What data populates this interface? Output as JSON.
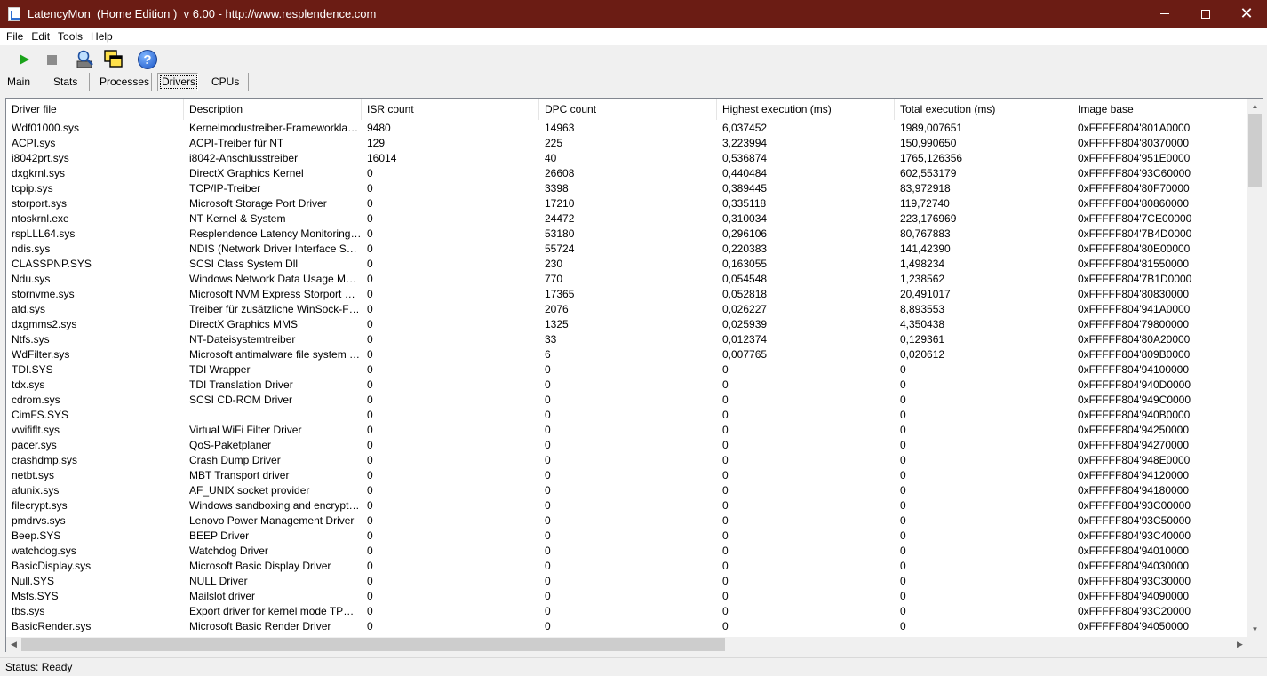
{
  "window": {
    "title": "LatencyMon  (Home Edition )  v 6.00 - http://www.resplendence.com"
  },
  "menu": [
    "File",
    "Edit",
    "Tools",
    "Help"
  ],
  "toolbar": {
    "start_icon": "play-icon",
    "stop_icon": "stop-icon",
    "find_icon": "magnifier-icon",
    "windows_icon": "cascade-windows-icon",
    "help_icon": "help-icon",
    "help_glyph": "?"
  },
  "tabs": [
    "Main",
    "Stats",
    "Processes",
    "Drivers",
    "CPUs"
  ],
  "selected_tab": "Drivers",
  "table": {
    "columns": [
      "Driver file",
      "Description",
      "ISR count",
      "DPC count",
      "Highest execution (ms)",
      "Total execution (ms)",
      "Image base"
    ],
    "rows": [
      [
        "Wdf01000.sys",
        "Kernelmodustreiber-Frameworklaufzeit",
        "9480",
        "14963",
        "6,037452",
        "1989,007651",
        "0xFFFFF804'801A0000"
      ],
      [
        "ACPI.sys",
        "ACPI-Treiber für NT",
        "129",
        "225",
        "3,223994",
        "150,990650",
        "0xFFFFF804'80370000"
      ],
      [
        "i8042prt.sys",
        "i8042-Anschlusstreiber",
        "16014",
        "40",
        "0,536874",
        "1765,126356",
        "0xFFFFF804'951E0000"
      ],
      [
        "dxgkrnl.sys",
        "DirectX Graphics Kernel",
        "0",
        "26608",
        "0,440484",
        "602,553179",
        "0xFFFFF804'93C60000"
      ],
      [
        "tcpip.sys",
        "TCP/IP-Treiber",
        "0",
        "3398",
        "0,389445",
        "83,972918",
        "0xFFFFF804'80F70000"
      ],
      [
        "storport.sys",
        "Microsoft Storage Port Driver",
        "0",
        "17210",
        "0,335118",
        "119,72740",
        "0xFFFFF804'80860000"
      ],
      [
        "ntoskrnl.exe",
        "NT Kernel & System",
        "0",
        "24472",
        "0,310034",
        "223,176969",
        "0xFFFFF804'7CE00000"
      ],
      [
        "rspLLL64.sys",
        "Resplendence Latency Monitoring a...",
        "0",
        "53180",
        "0,296106",
        "80,767883",
        "0xFFFFF804'7B4D0000"
      ],
      [
        "ndis.sys",
        "NDIS (Network Driver Interface Spe...",
        "0",
        "55724",
        "0,220383",
        "141,42390",
        "0xFFFFF804'80E00000"
      ],
      [
        "CLASSPNP.SYS",
        "SCSI Class System Dll",
        "0",
        "230",
        "0,163055",
        "1,498234",
        "0xFFFFF804'81550000"
      ],
      [
        "Ndu.sys",
        "Windows Network Data Usage Monit...",
        "0",
        "770",
        "0,054548",
        "1,238562",
        "0xFFFFF804'7B1D0000"
      ],
      [
        "stornvme.sys",
        "Microsoft NVM Express Storport Mini...",
        "0",
        "17365",
        "0,052818",
        "20,491017",
        "0xFFFFF804'80830000"
      ],
      [
        "afd.sys",
        "Treiber für zusätzliche WinSock-Fun...",
        "0",
        "2076",
        "0,026227",
        "8,893553",
        "0xFFFFF804'941A0000"
      ],
      [
        "dxgmms2.sys",
        "DirectX Graphics MMS",
        "0",
        "1325",
        "0,025939",
        "4,350438",
        "0xFFFFF804'79800000"
      ],
      [
        "Ntfs.sys",
        "NT-Dateisystemtreiber",
        "0",
        "33",
        "0,012374",
        "0,129361",
        "0xFFFFF804'80A20000"
      ],
      [
        "WdFilter.sys",
        "Microsoft antimalware file system filt...",
        "0",
        "6",
        "0,007765",
        "0,020612",
        "0xFFFFF804'809B0000"
      ],
      [
        "TDI.SYS",
        "TDI Wrapper",
        "0",
        "0",
        "0",
        "0",
        "0xFFFFF804'94100000"
      ],
      [
        "tdx.sys",
        "TDI Translation Driver",
        "0",
        "0",
        "0",
        "0",
        "0xFFFFF804'940D0000"
      ],
      [
        "cdrom.sys",
        "SCSI CD-ROM Driver",
        "0",
        "0",
        "0",
        "0",
        "0xFFFFF804'949C0000"
      ],
      [
        "CimFS.SYS",
        "",
        "0",
        "0",
        "0",
        "0",
        "0xFFFFF804'940B0000"
      ],
      [
        "vwififlt.sys",
        "Virtual WiFi Filter Driver",
        "0",
        "0",
        "0",
        "0",
        "0xFFFFF804'94250000"
      ],
      [
        "pacer.sys",
        "QoS-Paketplaner",
        "0",
        "0",
        "0",
        "0",
        "0xFFFFF804'94270000"
      ],
      [
        "crashdmp.sys",
        "Crash Dump Driver",
        "0",
        "0",
        "0",
        "0",
        "0xFFFFF804'948E0000"
      ],
      [
        "netbt.sys",
        "MBT Transport driver",
        "0",
        "0",
        "0",
        "0",
        "0xFFFFF804'94120000"
      ],
      [
        "afunix.sys",
        "AF_UNIX socket provider",
        "0",
        "0",
        "0",
        "0",
        "0xFFFFF804'94180000"
      ],
      [
        "filecrypt.sys",
        "Windows sandboxing and encryptio...",
        "0",
        "0",
        "0",
        "0",
        "0xFFFFF804'93C00000"
      ],
      [
        "pmdrvs.sys",
        "Lenovo Power Management Driver",
        "0",
        "0",
        "0",
        "0",
        "0xFFFFF804'93C50000"
      ],
      [
        "Beep.SYS",
        "BEEP Driver",
        "0",
        "0",
        "0",
        "0",
        "0xFFFFF804'93C40000"
      ],
      [
        "watchdog.sys",
        "Watchdog Driver",
        "0",
        "0",
        "0",
        "0",
        "0xFFFFF804'94010000"
      ],
      [
        "BasicDisplay.sys",
        "Microsoft Basic Display Driver",
        "0",
        "0",
        "0",
        "0",
        "0xFFFFF804'94030000"
      ],
      [
        "Null.SYS",
        "NULL Driver",
        "0",
        "0",
        "0",
        "0",
        "0xFFFFF804'93C30000"
      ],
      [
        "Msfs.SYS",
        "Mailslot driver",
        "0",
        "0",
        "0",
        "0",
        "0xFFFFF804'94090000"
      ],
      [
        "tbs.sys",
        "Export driver for kernel mode TPM API",
        "0",
        "0",
        "0",
        "0",
        "0xFFFFF804'93C20000"
      ],
      [
        "BasicRender.sys",
        "Microsoft Basic Render Driver",
        "0",
        "0",
        "0",
        "0",
        "0xFFFFF804'94050000"
      ]
    ]
  },
  "status": "Status: Ready"
}
